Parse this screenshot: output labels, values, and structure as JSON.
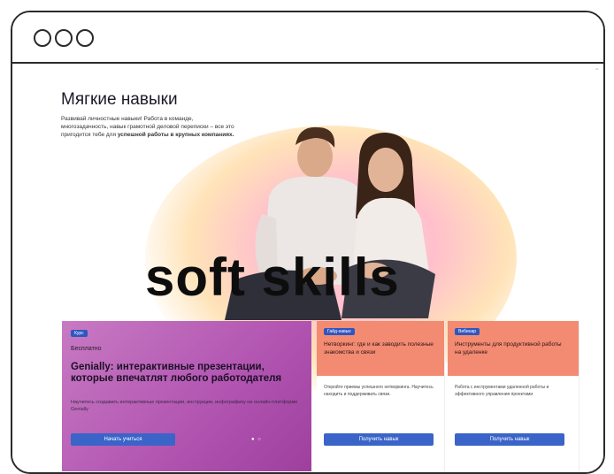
{
  "hero": {
    "title": "Мягкие навыки",
    "text_plain": "Развивай личностные навыки! Работа в команде, многозадачность, навык грамотной деловой переписки – все это пригодится тебе для ",
    "text_bold": "успешной работы в крупных компаниях.",
    "banner": "soft skills"
  },
  "cards": [
    {
      "badge": "Курс",
      "label": "Бесплатно",
      "title": "Genially: интерактивные презентации, которые впечатлят любого работодателя",
      "desc": "Научитесь создавать интерактивные презентации, инструкции, инфографику на онлайн-платформе Genially",
      "button": "Начать учиться",
      "pager": "● ○"
    },
    {
      "badge": "Гайд-навык",
      "title": "Нетворкинг: где и как заводить полезные знакомства и связи",
      "desc": "Откройте приемы успешного нетворкинга. Научитесь находить и поддерживать связи.",
      "button": "Получить навык"
    },
    {
      "badge": "Вебинар",
      "title": "Инструменты для продуктивной работы на удаленке",
      "desc": "Работа с инструментами удаленной работы и эффективного управления проектами",
      "button": "Получить навык"
    }
  ],
  "colors": {
    "main_card": "#b357b3",
    "small_card_head": "#f38a72",
    "button": "#3a64c8",
    "badge": "#2f56c0",
    "frame": "#2a2a2a"
  }
}
